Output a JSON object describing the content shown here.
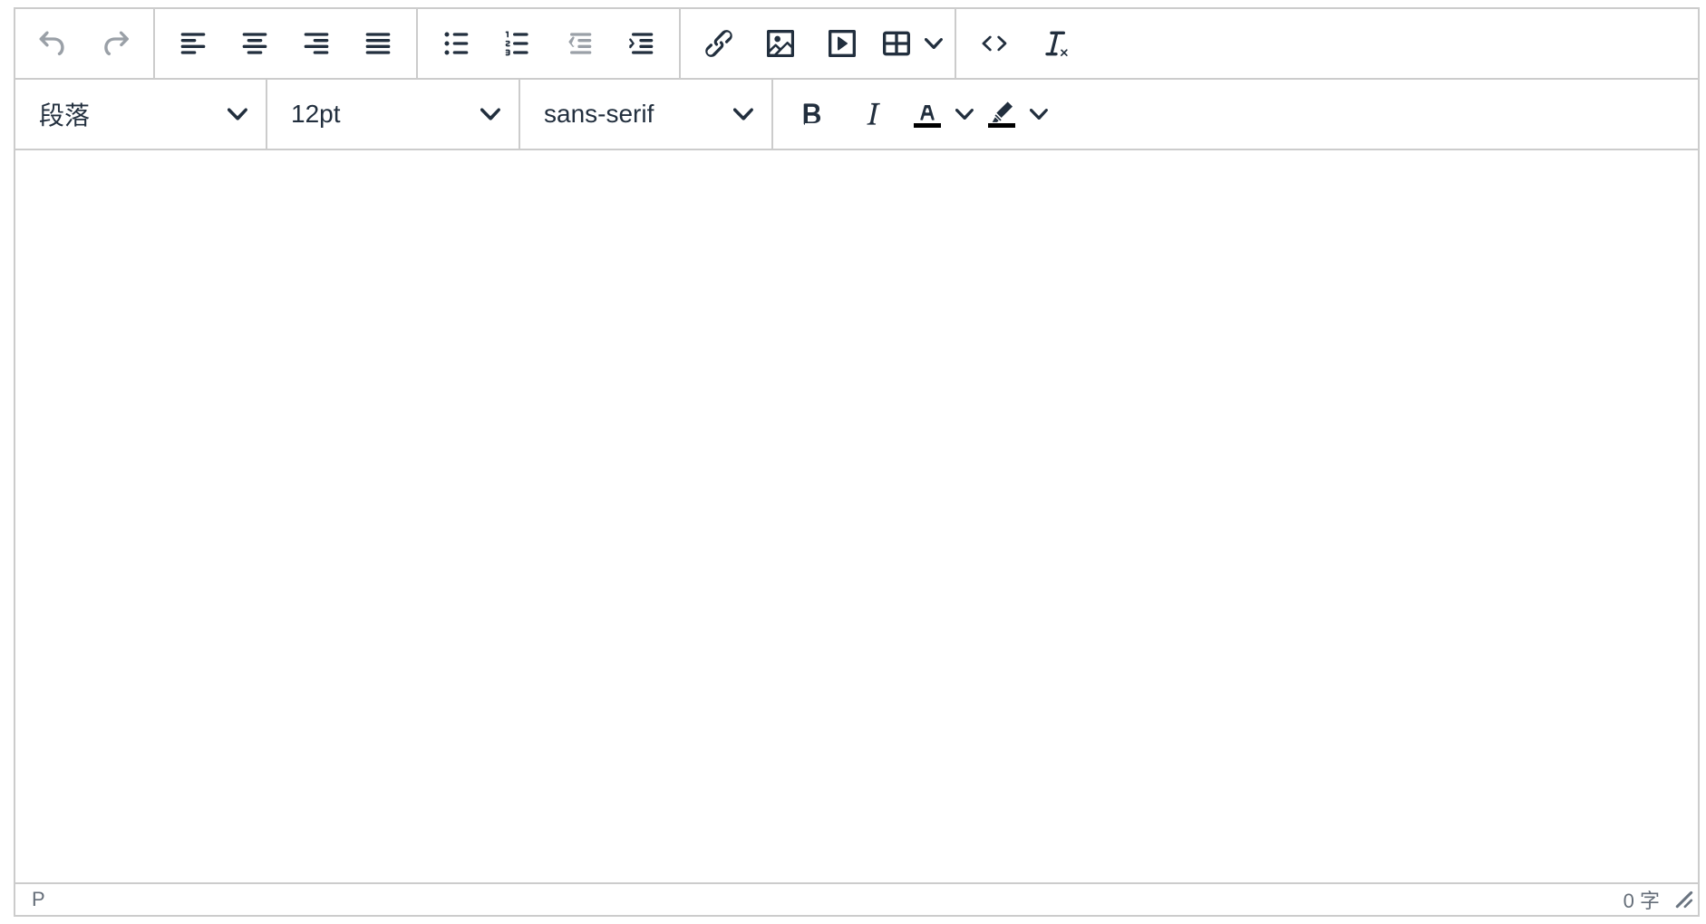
{
  "toolbar": {
    "row1": {
      "history": [
        {
          "icon": "undo-icon",
          "disabled": true
        },
        {
          "icon": "redo-icon",
          "disabled": true
        }
      ],
      "align": [
        {
          "icon": "align-left-icon"
        },
        {
          "icon": "align-center-icon"
        },
        {
          "icon": "align-right-icon"
        },
        {
          "icon": "align-justify-icon"
        }
      ],
      "lists": [
        {
          "icon": "bullet-list-icon"
        },
        {
          "icon": "numbered-list-icon"
        },
        {
          "icon": "outdent-icon",
          "disabled": true
        },
        {
          "icon": "indent-icon"
        }
      ],
      "insert": [
        {
          "icon": "link-icon"
        },
        {
          "icon": "image-icon"
        },
        {
          "icon": "media-icon"
        },
        {
          "icon": "table-icon",
          "has_dropdown": true
        }
      ],
      "tools": [
        {
          "icon": "source-code-icon"
        },
        {
          "icon": "clear-formatting-icon"
        }
      ]
    },
    "row2": {
      "block_format": {
        "value": "段落"
      },
      "font_size": {
        "value": "12pt"
      },
      "font_family": {
        "value": "sans-serif"
      },
      "formatting": [
        {
          "icon": "bold-icon"
        },
        {
          "icon": "italic-icon"
        },
        {
          "icon": "text-color-icon",
          "has_dropdown": true,
          "swatch": "#000000"
        },
        {
          "icon": "highlight-icon",
          "has_dropdown": true,
          "swatch": "#000000"
        }
      ]
    }
  },
  "statusbar": {
    "path": "P",
    "word_count": "0 字"
  },
  "colors": {
    "icon": "#222f3e",
    "border": "#cccccc",
    "status_text": "#6a7480"
  }
}
